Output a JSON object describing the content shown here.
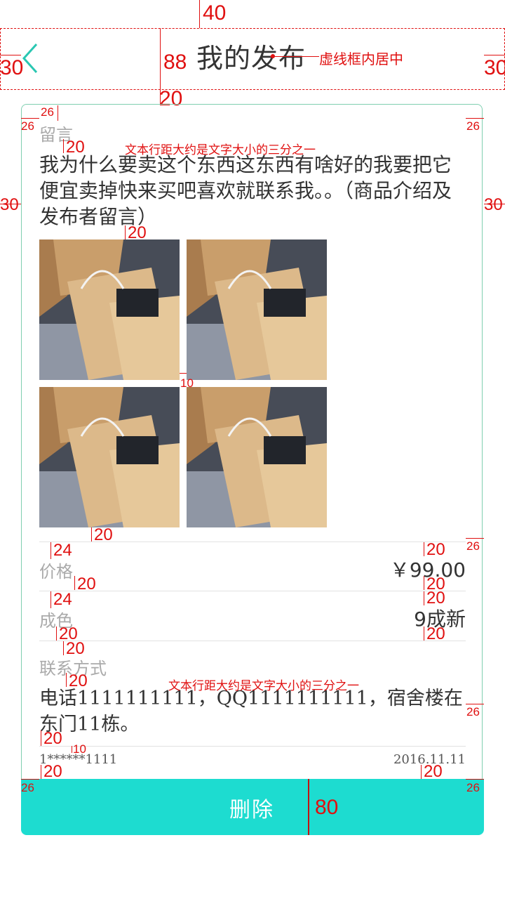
{
  "header": {
    "title": "我的发布",
    "back_icon": "chevron-left-icon",
    "note": "虚线框内居中"
  },
  "message": {
    "label": "留言",
    "text": "我为什么要卖这个东西这东西有啥好的我要把它便宜卖掉快来买吧喜欢就联系我。。（商品介绍及发布者留言）"
  },
  "photos": [
    {
      "alt": "shopping-bags"
    },
    {
      "alt": "shopping-bags"
    },
    {
      "alt": "shopping-bags"
    },
    {
      "alt": "shopping-bags"
    }
  ],
  "price": {
    "label": "价格",
    "value": "￥99.00"
  },
  "condition": {
    "label": "成色",
    "value": "9成新"
  },
  "contact": {
    "label": "联系方式",
    "text": "电话1111111111，QQ1111111111，宿舍楼在东门11栋。"
  },
  "footer": {
    "phone": "1******1111",
    "date": "2016.11.11"
  },
  "delete_button": {
    "label": "删除"
  },
  "annotations": {
    "a40": "40",
    "a88": "88",
    "a30l": "30",
    "a30r": "30",
    "a20_hdr": "20",
    "a26_top": "26",
    "a26_left": "26",
    "a26_right": "26",
    "a20_msg": "20",
    "note_spacing_1": "文本行距大约是文字大小的三分之一",
    "a30_midl": "30",
    "a30_midr": "30",
    "a20_img": "20",
    "a10_img": "10",
    "a20_imgbot": "20",
    "a24_price": "24",
    "a20_price_r": "20",
    "a26_price": "26",
    "a20_price_b": "20",
    "a20_price_rb": "20",
    "a24_cond": "24",
    "a20_cond_r": "20",
    "a20_cond_b": "20",
    "a20_cond_rb": "20",
    "a20_contact_t": "20",
    "a20_contact_b": "20",
    "note_spacing_2": "文本行距大约是文字大小的三分之一",
    "a26_contact": "26",
    "a20_foot": "20",
    "a10_foot": "10",
    "a20_foot_b": "20",
    "a20_foot_rb": "20",
    "a26_bl": "26",
    "a26_br": "26",
    "a80": "80"
  },
  "colors": {
    "accent": "#1ddcd0",
    "card_border": "#7fcfb0",
    "annotation": "#e01010",
    "gray_text": "#aaaaaa"
  }
}
